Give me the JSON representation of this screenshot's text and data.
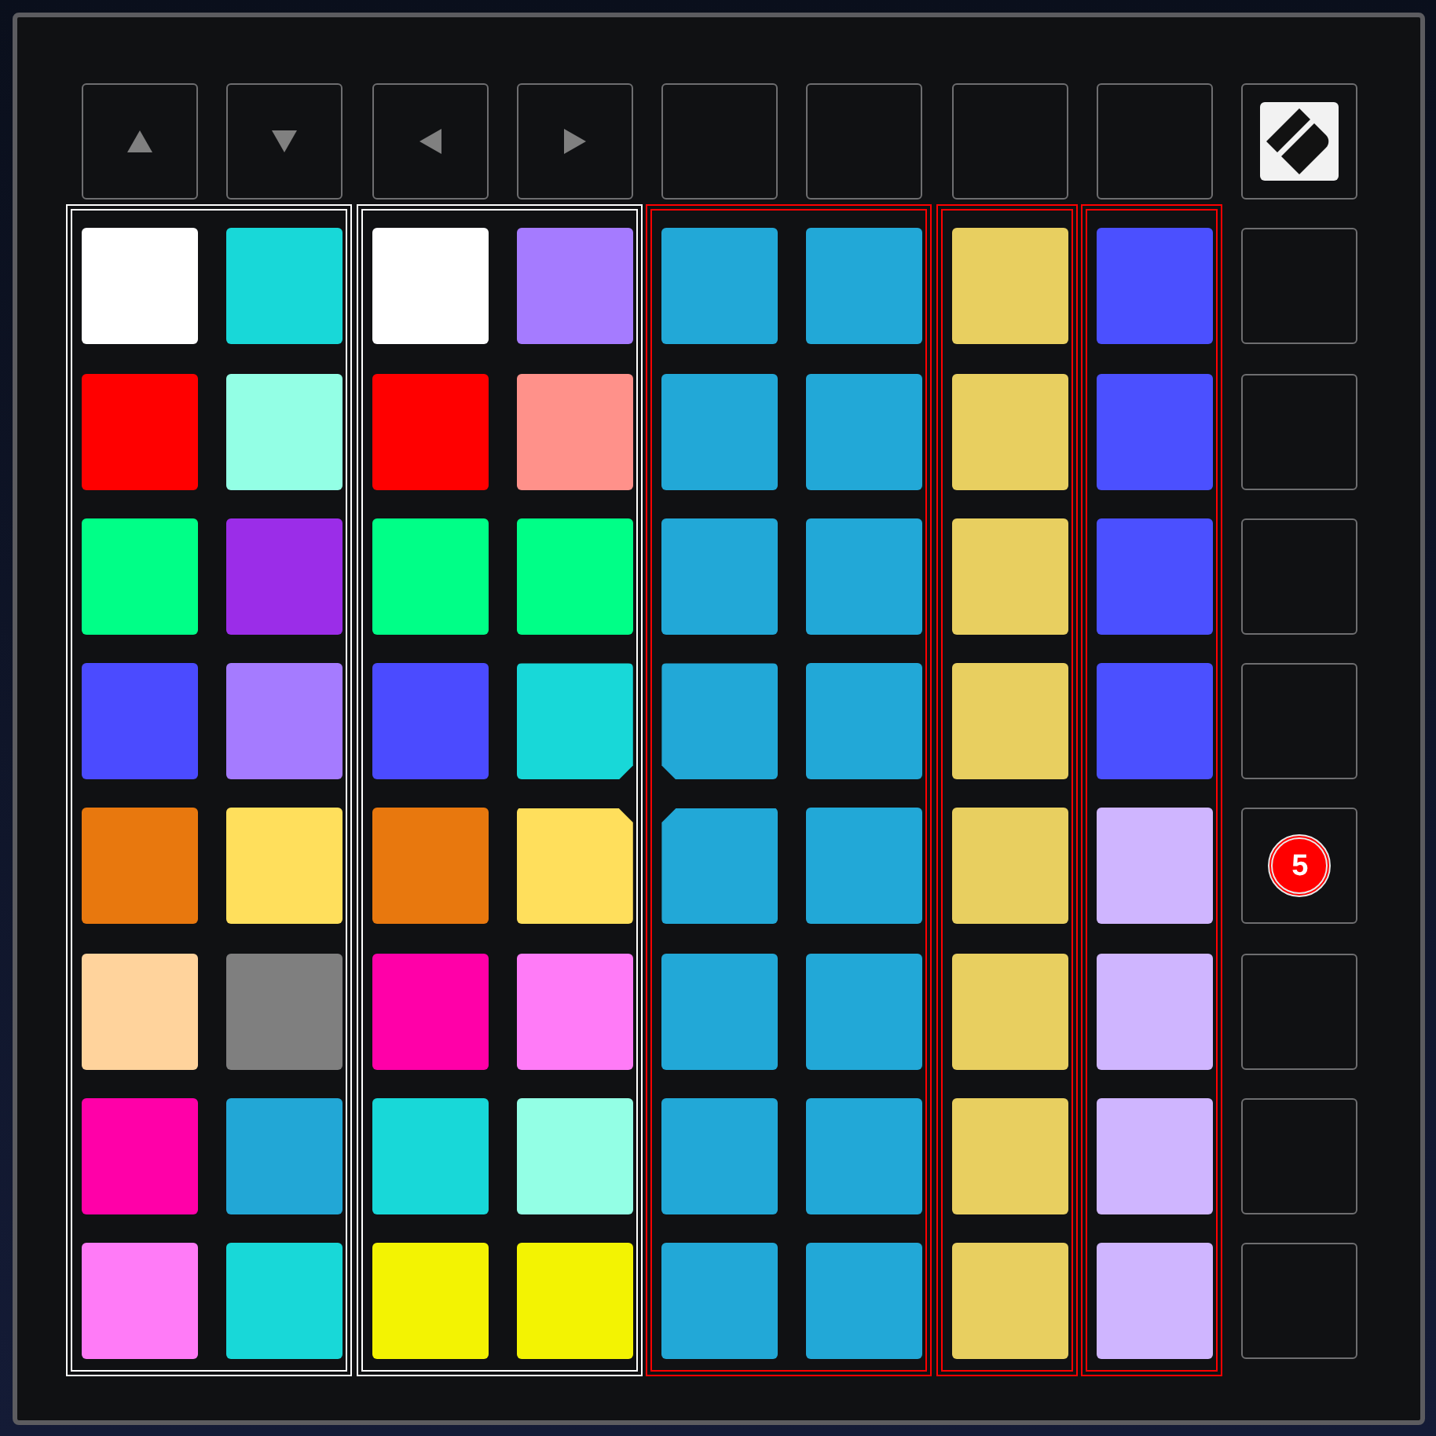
{
  "top_row": [
    {
      "kind": "up"
    },
    {
      "kind": "down"
    },
    {
      "kind": "left"
    },
    {
      "kind": "right"
    },
    {
      "kind": "blank"
    },
    {
      "kind": "blank"
    },
    {
      "kind": "blank"
    },
    {
      "kind": "blank"
    },
    {
      "kind": "logo"
    }
  ],
  "groups": [
    {
      "color": "#ffffff",
      "columns": [
        {
          "pads": [
            {
              "color": "#ffffff"
            },
            {
              "color": "#ff0000"
            },
            {
              "color": "#00ff87"
            },
            {
              "color": "#4b4bff"
            },
            {
              "color": "#e8780e"
            },
            {
              "color": "#ffd39c"
            },
            {
              "color": "#ff00a8"
            },
            {
              "color": "#ff7bf7"
            }
          ]
        },
        {
          "pads": [
            {
              "color": "#18d8d8"
            },
            {
              "color": "#93ffe5"
            },
            {
              "color": "#9b2de8"
            },
            {
              "color": "#a57bff"
            },
            {
              "color": "#ffdf5c"
            },
            {
              "color": "#7f7f7f"
            },
            {
              "color": "#22a7d6"
            },
            {
              "color": "#18d8d8"
            }
          ]
        }
      ]
    },
    {
      "color": "#ffffff",
      "columns": [
        {
          "pads": [
            {
              "color": "#ffffff"
            },
            {
              "color": "#ff0000"
            },
            {
              "color": "#00ff87"
            },
            {
              "color": "#4b4bff"
            },
            {
              "color": "#e8780e"
            },
            {
              "color": "#ff00a8"
            },
            {
              "color": "#18d8d8"
            },
            {
              "color": "#f3f302"
            }
          ]
        },
        {
          "pads": [
            {
              "color": "#a57bff"
            },
            {
              "color": "#ff918a"
            },
            {
              "color": "#00ff87"
            },
            {
              "color": "#18d8d8"
            },
            {
              "color": "#ffdf5c"
            },
            {
              "color": "#ff7bf7"
            },
            {
              "color": "#93ffe5"
            },
            {
              "color": "#f3f302"
            }
          ]
        }
      ]
    },
    {
      "color": "#ff0000",
      "columns": [
        {
          "pads": [
            {
              "color": "#22a8d7"
            },
            {
              "color": "#22a8d7"
            },
            {
              "color": "#22a8d7"
            },
            {
              "color": "#22a8d7"
            },
            {
              "color": "#22a8d7"
            },
            {
              "color": "#22a8d7"
            },
            {
              "color": "#22a8d7"
            },
            {
              "color": "#22a8d7"
            }
          ]
        },
        {
          "pads": [
            {
              "color": "#22a8d7"
            },
            {
              "color": "#22a8d7"
            },
            {
              "color": "#22a8d7"
            },
            {
              "color": "#22a8d7"
            },
            {
              "color": "#22a8d7"
            },
            {
              "color": "#22a8d7"
            },
            {
              "color": "#22a8d7"
            },
            {
              "color": "#22a8d7"
            }
          ]
        }
      ]
    },
    {
      "color": "#ff0000",
      "columns": [
        {
          "pads": [
            {
              "color": "#e8cf60"
            },
            {
              "color": "#e8cf60"
            },
            {
              "color": "#e8cf60"
            },
            {
              "color": "#e8cf60"
            },
            {
              "color": "#e8cf60"
            },
            {
              "color": "#e8cf60"
            },
            {
              "color": "#e8cf60"
            },
            {
              "color": "#e8cf60"
            }
          ]
        }
      ]
    },
    {
      "color": "#ff0000",
      "columns": [
        {
          "pads": [
            {
              "color": "#4b50ff"
            },
            {
              "color": "#4b50ff"
            },
            {
              "color": "#4b50ff"
            },
            {
              "color": "#4b50ff"
            },
            {
              "color": "#cfb5ff"
            },
            {
              "color": "#cfb5ff"
            },
            {
              "color": "#cfb5ff"
            },
            {
              "color": "#cfb5ff"
            }
          ]
        }
      ]
    }
  ],
  "side_column": [
    {
      "kind": "plain"
    },
    {
      "kind": "plain"
    },
    {
      "kind": "plain"
    },
    {
      "kind": "plain"
    },
    {
      "kind": "badge",
      "badge": "5"
    },
    {
      "kind": "plain"
    },
    {
      "kind": "plain"
    },
    {
      "kind": "plain"
    }
  ]
}
